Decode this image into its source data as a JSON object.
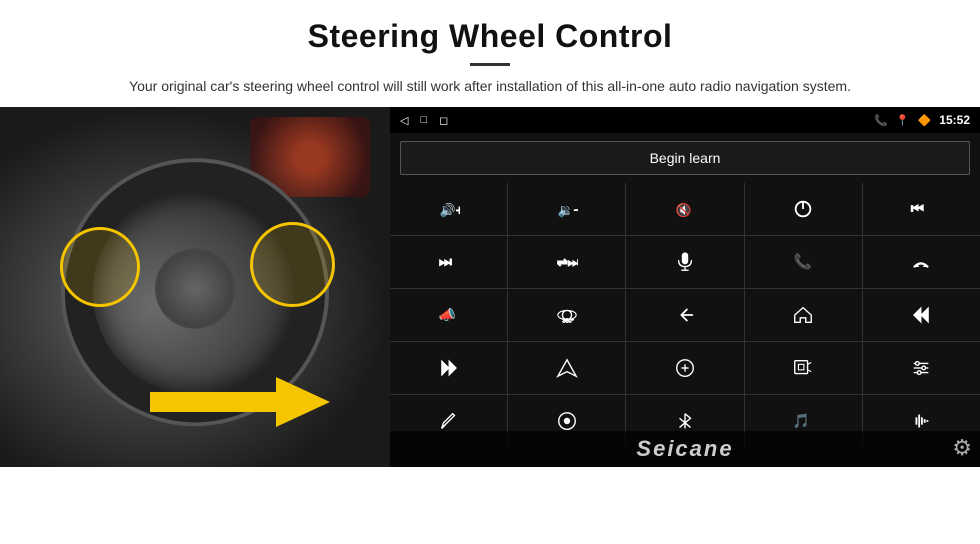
{
  "header": {
    "title": "Steering Wheel Control",
    "description": "Your original car's steering wheel control will still work after installation of this all-in-one auto radio navigation system."
  },
  "status_bar": {
    "time": "15:52",
    "back_icon": "◁",
    "home_icon": "□",
    "recent_icon": "◻"
  },
  "begin_learn": {
    "label": "Begin learn"
  },
  "controls": {
    "rows": [
      [
        "vol+",
        "vol-",
        "mute",
        "power",
        "prev-track"
      ],
      [
        "skip-next",
        "shuffle",
        "mic",
        "phone",
        "hang-up"
      ],
      [
        "horn",
        "360-camera",
        "back",
        "home",
        "skip-prev"
      ],
      [
        "fast-forward",
        "navigate",
        "equalizer",
        "media",
        "settings-sliders"
      ],
      [
        "edit",
        "record",
        "bluetooth",
        "music",
        "sound-wave"
      ]
    ]
  },
  "seicane": {
    "watermark": "Seicane"
  }
}
